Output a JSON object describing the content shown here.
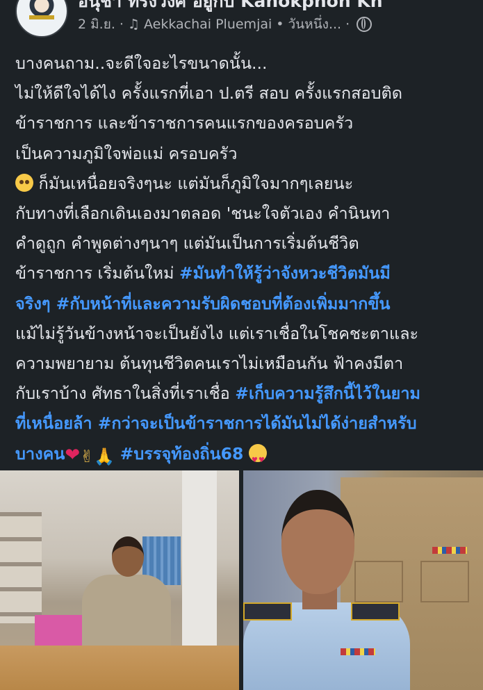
{
  "post": {
    "author": "อนุชา ทรงวงศ์ อยู่กับ Kanokphon Kh",
    "date": "2 มิ.ย.",
    "separator": "·",
    "music": "Aekkachai Pluemjai",
    "music_suffix": "• วันหนึ่ง...",
    "lines": [
      [
        {
          "t": "บางคนถาม..จะดีใจอะไรขนาดนั้น...",
          "h": false
        }
      ],
      [
        {
          "t": "ไม่ให้ดีใจได้ไง ครั้งแรกที่เอา ป.ตรี สอบ ครั้งแรกสอบติด",
          "h": false
        }
      ],
      [
        {
          "t": "ข้าราชการ และข้าราชการคนแรกของครอบครัว",
          "h": false
        }
      ],
      [
        {
          "t": "เป็นความภูมิใจพ่อแม่ ครอบครัว",
          "h": false
        }
      ],
      [
        {
          "t": "ก็มันเหนื่อยจริงๆนะ แต่มันก็ภูมิใจมากๆเลยนะ",
          "h": false
        }
      ],
      [
        {
          "t": "กับทางที่เลือกเดินเองมาตลอด 'ชนะใจตัวเอง  คำนินทา",
          "h": false
        }
      ],
      [
        {
          "t": "คำดูถูก คำพูดต่างๆนาๆ แต่มันเป็นการเริ่มต้นชีวิต",
          "h": false
        }
      ],
      [
        {
          "t": "ข้าราชการ เริ่มต้นใหม่ ",
          "h": false
        },
        {
          "t": "#มันทำให้รู้ว่าจังหวะชีวิตมันมี",
          "h": true
        }
      ],
      [
        {
          "t": "จริงๆ #กับหน้าที่และความรับผิดชอบที่ต้องเพิ่มมากขึ้น",
          "h": true
        }
      ],
      [
        {
          "t": "แม้ไม่รู้วันข้างหน้าจะเป็นยังไง แต่เราเชื่อในโชคชะตาและ",
          "h": false
        }
      ],
      [
        {
          "t": "ความพยายาม ต้นทุนชีวิตคนเราไม่เหมือนกัน ฟ้าคงมีตา",
          "h": false
        }
      ],
      [
        {
          "t": "กับเราบ้าง ศัทธาในสิ่งที่เราเชื่อ ",
          "h": false
        },
        {
          "t": "#เก็บความรู้สึกนี้ไว้ในยาม",
          "h": true
        }
      ],
      [
        {
          "t": "ที่เหนื่อยล้า #กว่าจะเป็นข้าราชการได้มันไม่ได้ง่ายสำหรับ",
          "h": true
        }
      ],
      [
        {
          "t": "บางคน",
          "h": true
        },
        {
          "t": " ",
          "h": false
        },
        {
          "t": "#บรรจุท้องถิ่น68",
          "h": true
        }
      ]
    ],
    "emojis": {
      "sad_face": "pleading-face",
      "heart": "❤",
      "victory": "✌",
      "pray": "🙏",
      "love_face": "smiling-face-with-hearts"
    },
    "photos": [
      {
        "name": "photo-office-uniform"
      },
      {
        "name": "photo-white-uniform"
      }
    ]
  },
  "colors": {
    "background": "#1d2226",
    "text": "#e4e6eb",
    "meta": "#b0b3b8",
    "hashtag": "#4599ff"
  }
}
